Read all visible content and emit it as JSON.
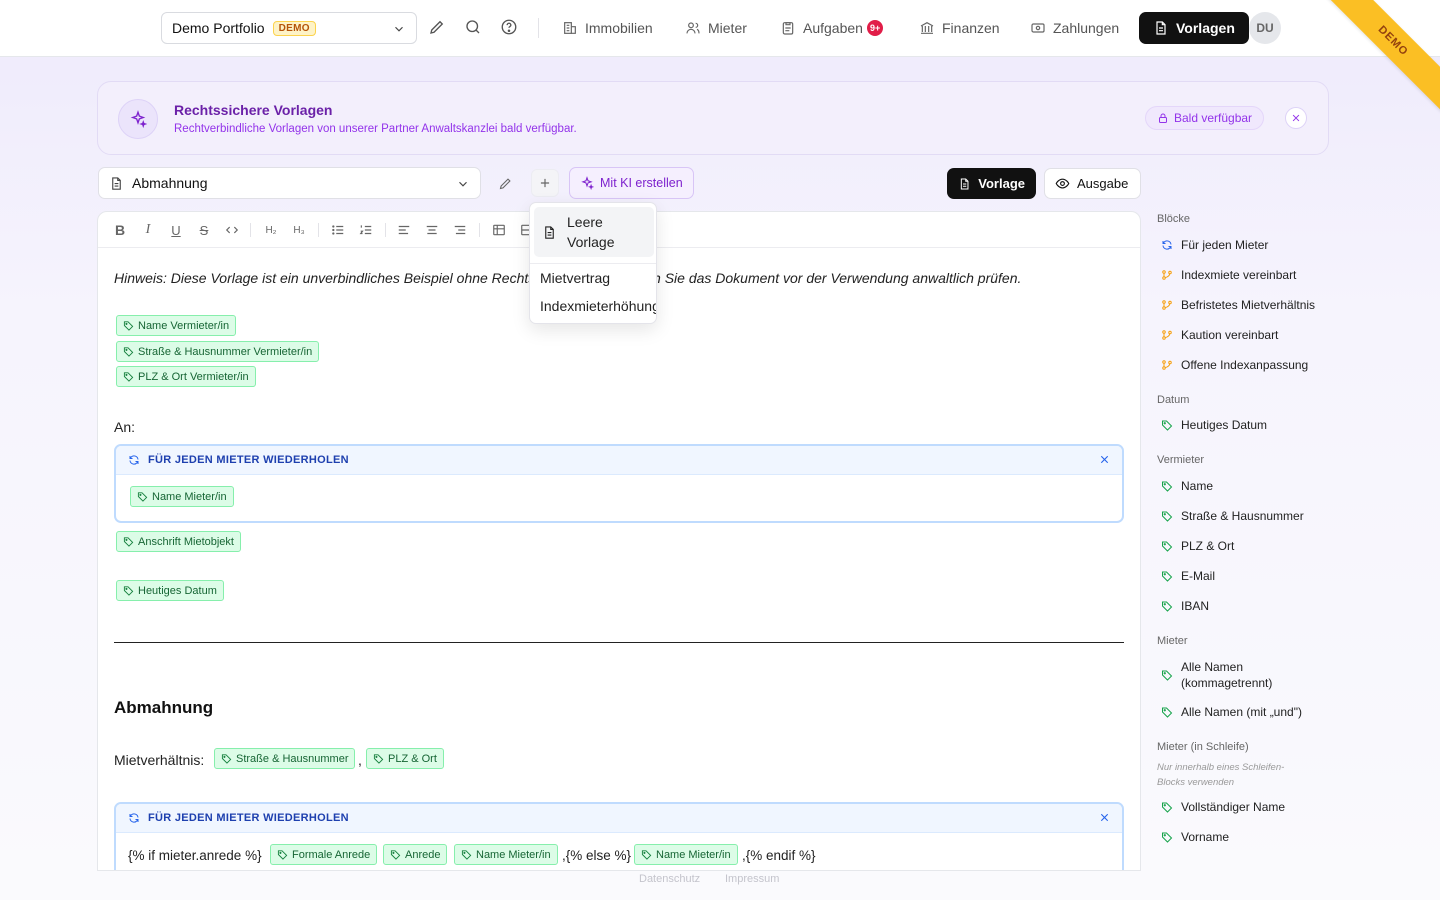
{
  "topbar": {
    "portfolio": {
      "name": "Demo Portfolio",
      "badge": "DEMO"
    },
    "nav": [
      {
        "label": "Immobilien",
        "icon": "building-icon"
      },
      {
        "label": "Mieter",
        "icon": "users-icon"
      },
      {
        "label": "Aufgaben",
        "icon": "clipboard-icon",
        "badge": "9+"
      },
      {
        "label": "Finanzen",
        "icon": "bank-icon"
      },
      {
        "label": "Zahlungen",
        "icon": "banknote-icon"
      },
      {
        "label": "Vorlagen",
        "icon": "document-icon",
        "active": true
      }
    ],
    "avatar": "DU",
    "ribbon": "DEMO"
  },
  "banner": {
    "title": "Rechtssichere Vorlagen",
    "subtitle": "Rechtverbindliche Vorlagen von unserer Partner Anwaltskanzlei bald verfügbar.",
    "button": "Bald verfügbar"
  },
  "toolbar": {
    "template": "Abmahnung",
    "ki_button": "Mit KI erstellen",
    "view_vorlage": "Vorlage",
    "view_ausgabe": "Ausgabe"
  },
  "dropdown": {
    "items": [
      "Leere Vorlage",
      "Mietvertrag",
      "Indexmieterhöhung"
    ]
  },
  "editor": {
    "hint": "Hinweis: Diese Vorlage ist ein unverbindliches Beispiel ohne Rechtsgewähr. Bitte lassen Sie das Dokument vor der Verwendung anwaltlich prüfen.",
    "sender_chips": [
      "Name Vermieter/in",
      "Straße & Hausnummer Vermieter/in",
      "PLZ & Ort Vermieter/in"
    ],
    "an_label": "An:",
    "loop_label": "FÜR JEDEN MIETER WIEDERHOLEN",
    "loop1_chip": "Name Mieter/in",
    "address_chip": "Anschrift Mietobjekt",
    "date_chip": "Heutiges Datum",
    "heading": "Abmahnung",
    "mietverhaeltnis_label": "Mietverhältnis:",
    "mv_chip1": "Straße & Hausnummer",
    "mv_comma": ",",
    "mv_chip2": "PLZ & Ort",
    "loop2": {
      "pre": "{% if mieter.anrede %}",
      "chip1": "Formale Anrede",
      "chip2": "Anrede",
      "chip3": "Name Mieter/in",
      "mid": ",{% else %}",
      "chip4": "Name Mieter/in",
      "post": ",{% endif %}"
    }
  },
  "sidebar": {
    "sections": [
      {
        "title": "Blöcke",
        "items": [
          {
            "label": "Für jeden Mieter",
            "icon": "repeat-icon"
          },
          {
            "label": "Indexmiete vereinbart",
            "icon": "branch-icon"
          },
          {
            "label": "Befristetes Mietverhältnis",
            "icon": "branch-icon"
          },
          {
            "label": "Kaution vereinbart",
            "icon": "branch-icon"
          },
          {
            "label": "Offene Indexanpassung",
            "icon": "branch-icon"
          }
        ]
      },
      {
        "title": "Datum",
        "items": [
          {
            "label": "Heutiges Datum",
            "icon": "tag-icon"
          }
        ]
      },
      {
        "title": "Vermieter",
        "items": [
          {
            "label": "Name",
            "icon": "tag-icon"
          },
          {
            "label": "Straße & Hausnummer",
            "icon": "tag-icon"
          },
          {
            "label": "PLZ & Ort",
            "icon": "tag-icon"
          },
          {
            "label": "E-Mail",
            "icon": "tag-icon"
          },
          {
            "label": "IBAN",
            "icon": "tag-icon"
          }
        ]
      },
      {
        "title": "Mieter",
        "items": [
          {
            "label": "Alle Namen (kommagetrennt)",
            "icon": "tag-icon"
          },
          {
            "label": "Alle Namen (mit „und\")",
            "icon": "tag-icon"
          }
        ]
      },
      {
        "title": "Mieter (in Schleife)",
        "note": "Nur innerhalb eines Schleifen-Blocks verwenden",
        "items": [
          {
            "label": "Vollständiger Name",
            "icon": "tag-icon"
          },
          {
            "label": "Vorname",
            "icon": "tag-icon"
          }
        ]
      }
    ]
  },
  "footer": {
    "privacy": "Datenschutz",
    "imprint": "Impressum"
  },
  "colors": {
    "accent": "#7e22ce",
    "tag_green": "#dcfce7",
    "loop_blue": "#bfdbfe",
    "badge_red": "#e11d48"
  }
}
